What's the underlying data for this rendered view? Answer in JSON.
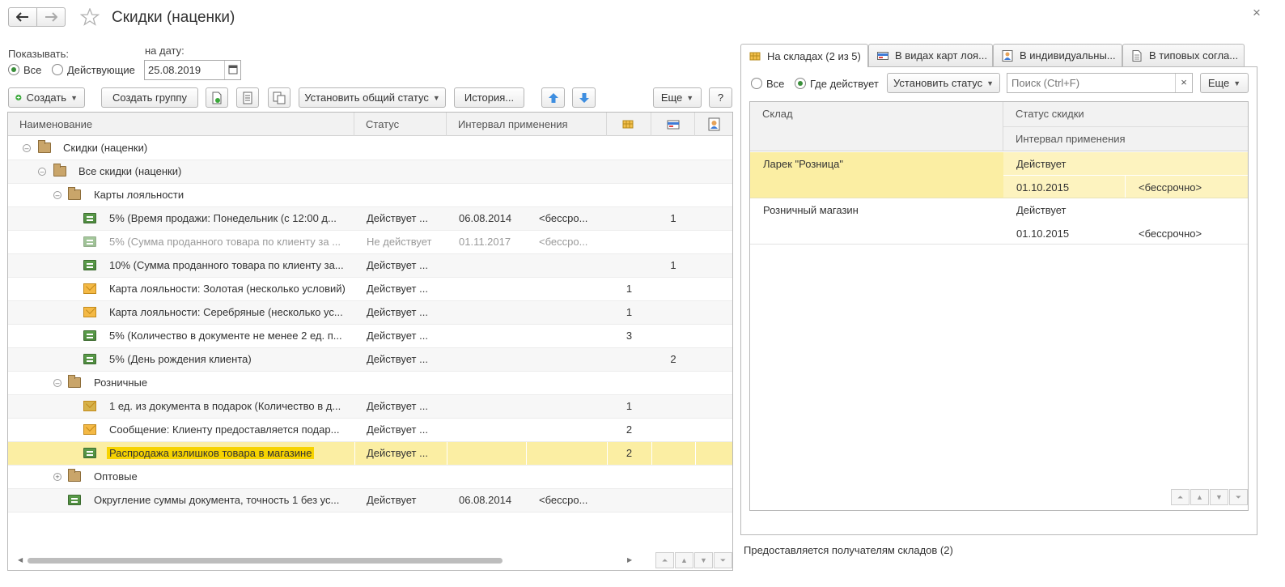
{
  "window": {
    "title": "Скидки (наценки)",
    "close_glyph": "×"
  },
  "filters": {
    "show_label": "Показывать:",
    "date_label": "на дату:",
    "opt_all": "Все",
    "opt_active": "Действующие",
    "date_value": "25.08.2019"
  },
  "toolbar": {
    "create": "Создать",
    "create_group": "Создать группу",
    "set_status": "Установить общий статус",
    "history": "История...",
    "more": "Еще",
    "help": "?"
  },
  "table": {
    "columns": [
      "Наименование",
      "Статус",
      "Интервал применения"
    ],
    "rows": [
      {
        "name": "Скидки (наценки)",
        "status": "",
        "from": "",
        "to": "",
        "c1": "",
        "c2": "",
        "c3": ""
      },
      {
        "name": "Все скидки (наценки)",
        "status": "",
        "from": "",
        "to": "",
        "c1": "",
        "c2": "",
        "c3": ""
      },
      {
        "name": "Карты лояльности",
        "status": "",
        "from": "",
        "to": "",
        "c1": "",
        "c2": "",
        "c3": ""
      },
      {
        "name": "5% (Время продажи: Понедельник (с 12:00 д...",
        "status": "Действует ...",
        "from": "06.08.2014",
        "to": "<бессро...",
        "c1": "",
        "c2": "1",
        "c3": ""
      },
      {
        "name": "5% (Сумма проданного товара по клиенту за ...",
        "status": "Не действует",
        "from": "01.11.2017",
        "to": "<бессро...",
        "c1": "",
        "c2": "",
        "c3": ""
      },
      {
        "name": "10% (Сумма проданного товара по клиенту за...",
        "status": "Действует ...",
        "from": "",
        "to": "",
        "c1": "",
        "c2": "1",
        "c3": ""
      },
      {
        "name": "Карта лояльности: Золотая (несколько условий)",
        "status": "Действует ...",
        "from": "",
        "to": "",
        "c1": "1",
        "c2": "",
        "c3": ""
      },
      {
        "name": "Карта лояльности: Серебряные (несколько ус...",
        "status": "Действует ...",
        "from": "",
        "to": "",
        "c1": "1",
        "c2": "",
        "c3": ""
      },
      {
        "name": "5% (Количество в документе не менее 2 ед. п...",
        "status": "Действует ...",
        "from": "",
        "to": "",
        "c1": "3",
        "c2": "",
        "c3": ""
      },
      {
        "name": "5% (День рождения клиента)",
        "status": "Действует ...",
        "from": "",
        "to": "",
        "c1": "",
        "c2": "2",
        "c3": ""
      },
      {
        "name": "Розничные",
        "status": "",
        "from": "",
        "to": "",
        "c1": "",
        "c2": "",
        "c3": ""
      },
      {
        "name": "1 ед. из документа в подарок (Количество в д...",
        "status": "Действует ...",
        "from": "",
        "to": "",
        "c1": "1",
        "c2": "",
        "c3": ""
      },
      {
        "name": "Сообщение: Клиенту предоставляется подар...",
        "status": "Действует ...",
        "from": "",
        "to": "",
        "c1": "2",
        "c2": "",
        "c3": ""
      },
      {
        "name": "Распродажа излишков товара в магазине",
        "status": "Действует ...",
        "from": "",
        "to": "",
        "c1": "2",
        "c2": "",
        "c3": ""
      },
      {
        "name": "Оптовые",
        "status": "",
        "from": "",
        "to": "",
        "c1": "",
        "c2": "",
        "c3": ""
      },
      {
        "name": "Округление суммы документа, точность 1 без ус...",
        "status": "Действует",
        "from": "06.08.2014",
        "to": "<бессро...",
        "c1": "",
        "c2": "",
        "c3": ""
      }
    ]
  },
  "right": {
    "tabs": [
      "На складах (2 из 5)",
      "В видах карт лоя...",
      "В индивидуальны...",
      "В типовых согла..."
    ],
    "opt_all": "Все",
    "opt_active": "Где действует",
    "set_status": "Установить статус",
    "search_placeholder": "Поиск (Ctrl+F)",
    "clear_glyph": "×",
    "more": "Еще",
    "columns": {
      "warehouse": "Склад",
      "status": "Статус скидки",
      "interval": "Интервал применения"
    },
    "rows": [
      {
        "warehouse": "Ларек \"Розница\"",
        "status": "Действует",
        "from": "01.10.2015",
        "to": "<бессрочно>"
      },
      {
        "warehouse": "Розничный магазин",
        "status": "Действует",
        "from": "01.10.2015",
        "to": "<бессрочно>"
      }
    ],
    "footer": "Предоставляется получателям складов (2)"
  }
}
